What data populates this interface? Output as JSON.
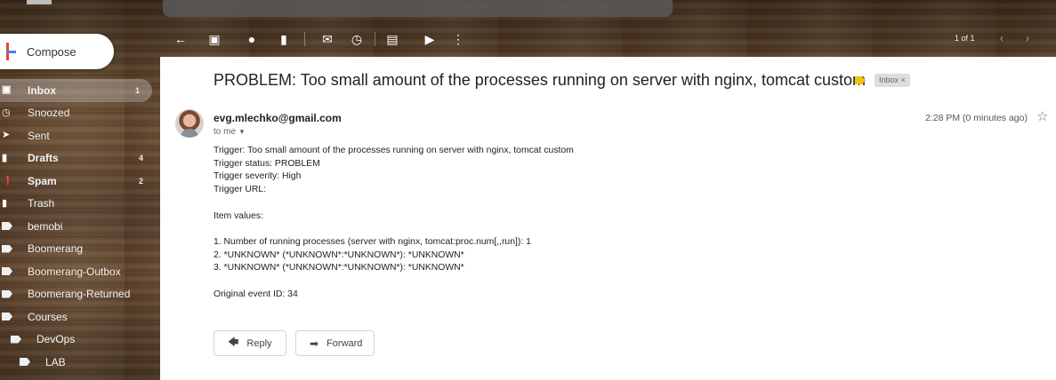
{
  "compose_label": "Compose",
  "sidebar": {
    "items": [
      {
        "label": "Inbox",
        "count": "1",
        "icon": "inbox-icon"
      },
      {
        "label": "Snoozed",
        "count": "",
        "icon": "clock-icon"
      },
      {
        "label": "Sent",
        "count": "",
        "icon": "send-icon"
      },
      {
        "label": "Drafts",
        "count": "4",
        "icon": "draft-icon"
      },
      {
        "label": "Spam",
        "count": "2",
        "icon": "spam-icon"
      },
      {
        "label": "Trash",
        "count": "",
        "icon": "trash-icon"
      },
      {
        "label": "bemobi",
        "count": "",
        "icon": "label-icon"
      },
      {
        "label": "Boomerang",
        "count": "",
        "icon": "label-icon"
      },
      {
        "label": "Boomerang-Outbox",
        "count": "",
        "icon": "label-icon"
      },
      {
        "label": "Boomerang-Returned",
        "count": "",
        "icon": "label-icon"
      },
      {
        "label": "Courses",
        "count": "",
        "icon": "label-icon"
      },
      {
        "label": "DevOps",
        "count": "",
        "icon": "label-icon"
      },
      {
        "label": "LAB",
        "count": "",
        "icon": "label-icon"
      }
    ]
  },
  "toolbar": {
    "icons": [
      "back-icon",
      "archive-icon",
      "report-spam-icon",
      "delete-icon",
      "mark-unread-icon",
      "snooze-icon",
      "move-to-icon",
      "labels-icon",
      "more-icon"
    ],
    "pager": "1 of 1"
  },
  "message": {
    "subject": "PROBLEM: Too small amount of the processes running on server with nginx, tomcat custom",
    "label_chip": "Inbox ×",
    "sender": "evg.mlechko@gmail.com",
    "to": "to me",
    "timestamp": "2:28 PM (0 minutes ago)",
    "body": {
      "line1": "Trigger: Too small amount of the processes running on server with nginx, tomcat custom",
      "line2": "Trigger status: PROBLEM",
      "line3": "Trigger severity: High",
      "line4": "Trigger URL:",
      "line5": "Item values:",
      "line6": "1. Number of running processes (server with nginx, tomcat:proc.num[,,run]): 1",
      "line7": "2. *UNKNOWN* (*UNKNOWN*:*UNKNOWN*): *UNKNOWN*",
      "line8": "3. *UNKNOWN* (*UNKNOWN*:*UNKNOWN*): *UNKNOWN*",
      "line9": "Original event ID: 34"
    },
    "reply_label": "Reply",
    "forward_label": "Forward"
  },
  "colors": {
    "important_marker": "#f4c20d",
    "compose_plus_red": "#ea4335",
    "compose_plus_blue": "#4285f4"
  }
}
